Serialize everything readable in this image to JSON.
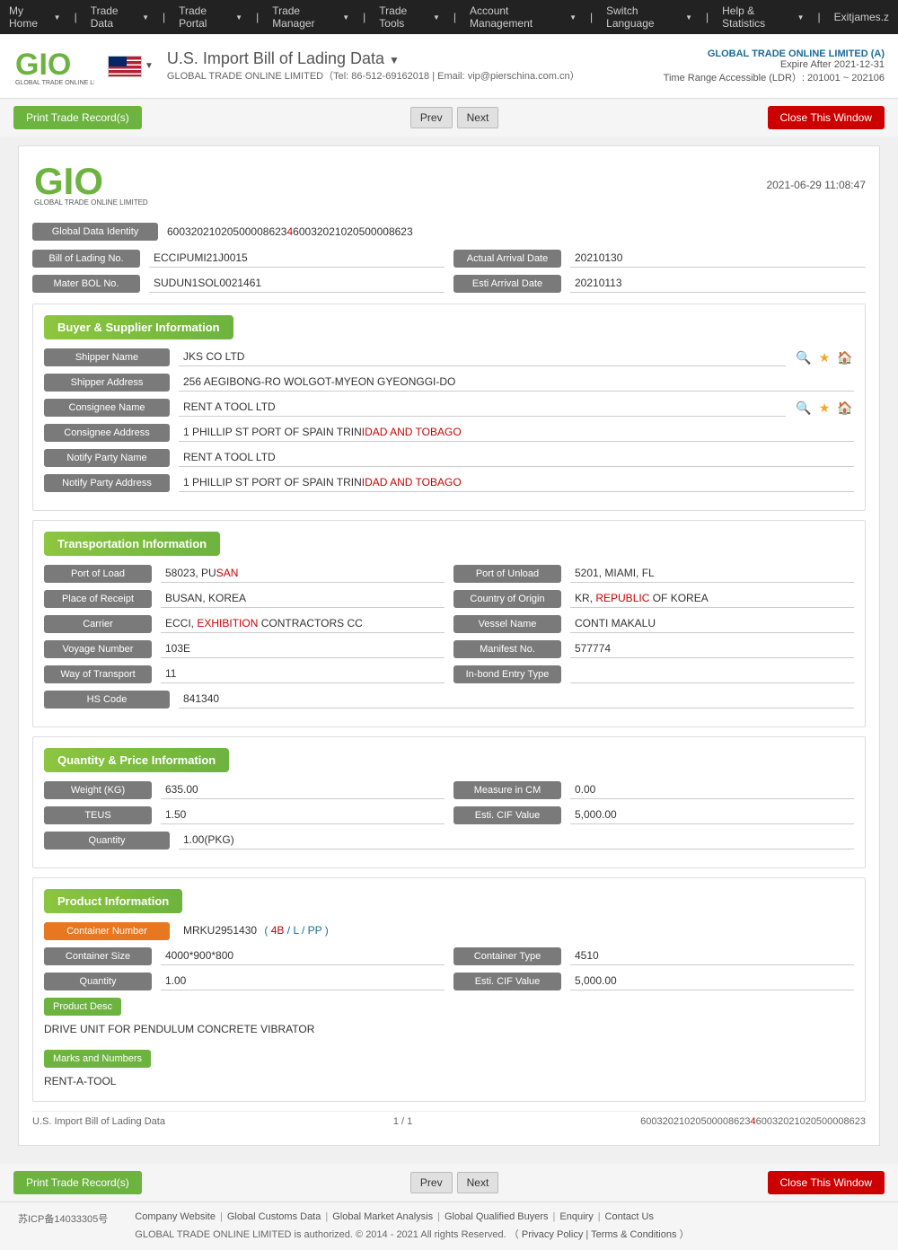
{
  "topnav": {
    "items": [
      "My Home",
      "Trade Data",
      "Trade Portal",
      "Trade Manager",
      "Trade Tools",
      "Account Management",
      "Switch Language",
      "Help & Statistics",
      "Exit"
    ],
    "user": "james.z"
  },
  "header": {
    "title": "U.S. Import Bill of Lading Data",
    "subtitle": "GLOBAL TRADE ONLINE LIMITED（Tel: 86-512-69162018 | Email: vip@pierschina.com.cn）",
    "company": "GLOBAL TRADE ONLINE LIMITED (A)",
    "expire": "Expire After 2021-12-31",
    "ldr": "Time Range Accessible (LDR）: 201001 ~ 202106"
  },
  "buttons": {
    "print": "Print Trade Record(s)",
    "prev": "Prev",
    "next": "Next",
    "close": "Close This Window"
  },
  "card": {
    "datetime": "2021-06-29 11:08:47",
    "global_data_identity": "60032021020500008623460032021020500008623",
    "global_id_label": "Global Data Identity",
    "global_id_value": "60032021020500008623460032021020500008623"
  },
  "bol": {
    "bill_label": "Bill of Lading No.",
    "bill_value": "ECCIPUMI21J0015",
    "actual_arrival_label": "Actual Arrival Date",
    "actual_arrival_value": "20210130",
    "mater_label": "Mater BOL No.",
    "mater_value": "SUDUN1SOL0021461",
    "esti_arrival_label": "Esti Arrival Date",
    "esti_arrival_value": "20210113"
  },
  "buyer_supplier": {
    "section_title": "Buyer & Supplier Information",
    "shipper_name_label": "Shipper Name",
    "shipper_name_value": "JKS CO LTD",
    "shipper_address_label": "Shipper Address",
    "shipper_address_value": "256 AEGIBONG-RO WOLGOT-MYEON GYEONGGI-DO",
    "consignee_name_label": "Consignee Name",
    "consignee_name_value": "RENT A TOOL LTD",
    "consignee_address_label": "Consignee Address",
    "consignee_address_value": "1 PHILLIP ST PORT OF SPAIN TRINIDAD AND TOBAGO",
    "notify_party_name_label": "Notify Party Name",
    "notify_party_name_value": "RENT A TOOL LTD",
    "notify_party_address_label": "Notify Party Address",
    "notify_party_address_value": "1 PHILLIP ST PORT OF SPAIN TRINIDAD AND TOBAGO"
  },
  "transportation": {
    "section_title": "Transportation Information",
    "port_load_label": "Port of Load",
    "port_load_value": "58023, PUSAN",
    "port_unload_label": "Port of Unload",
    "port_unload_value": "5201, MIAMI, FL",
    "place_receipt_label": "Place of Receipt",
    "place_receipt_value": "BUSAN, KOREA",
    "country_origin_label": "Country of Origin",
    "country_origin_value": "KR, REPUBLIC OF KOREA",
    "carrier_label": "Carrier",
    "carrier_value": "ECCI, EXHIBITION CONTRACTORS CC",
    "vessel_name_label": "Vessel Name",
    "vessel_name_value": "CONTI MAKALU",
    "voyage_label": "Voyage Number",
    "voyage_value": "103E",
    "manifest_label": "Manifest No.",
    "manifest_value": "577774",
    "way_transport_label": "Way of Transport",
    "way_transport_value": "11",
    "inbond_label": "In-bond Entry Type",
    "inbond_value": "",
    "hs_code_label": "HS Code",
    "hs_code_value": "841340"
  },
  "quantity_price": {
    "section_title": "Quantity & Price Information",
    "weight_label": "Weight (KG)",
    "weight_value": "635.00",
    "measure_label": "Measure in CM",
    "measure_value": "0.00",
    "teus_label": "TEUS",
    "teus_value": "1.50",
    "esti_cif_label": "Esti. CIF Value",
    "esti_cif_value": "5,000.00",
    "quantity_label": "Quantity",
    "quantity_value": "1.00(PKG)"
  },
  "product": {
    "section_title": "Product Information",
    "container_number_label": "Container Number",
    "container_number_value": "MRKU2951430",
    "container_number_suffix": "( 4B / L / PP )",
    "container_size_label": "Container Size",
    "container_size_value": "4000*900*800",
    "container_type_label": "Container Type",
    "container_type_value": "4510",
    "quantity_label": "Quantity",
    "quantity_value": "1.00",
    "esti_cif_label": "Esti. CIF Value",
    "esti_cif_value": "5,000.00",
    "product_desc_label": "Product Desc",
    "product_desc_value": "DRIVE UNIT FOR PENDULUM CONCRETE VIBRATOR",
    "marks_label": "Marks and Numbers",
    "marks_value": "RENT-A-TOOL"
  },
  "record_footer": {
    "left": "U.S. Import Bill of Lading Data",
    "center": "1 / 1",
    "right": "60032021020500008623460032021020500008623"
  },
  "footer": {
    "links": [
      "Company Website",
      "Global Customs Data",
      "Global Market Analysis",
      "Global Qualified Buyers",
      "Enquiry",
      "Contact Us"
    ],
    "copy": "GLOBAL TRADE ONLINE LIMITED is authorized. © 2014 - 2021 All rights Reserved.  （",
    "privacy": "Privacy Policy",
    "terms": "Terms & Conditions",
    "copy_end": "）",
    "beian": "苏ICP备14033305号"
  }
}
